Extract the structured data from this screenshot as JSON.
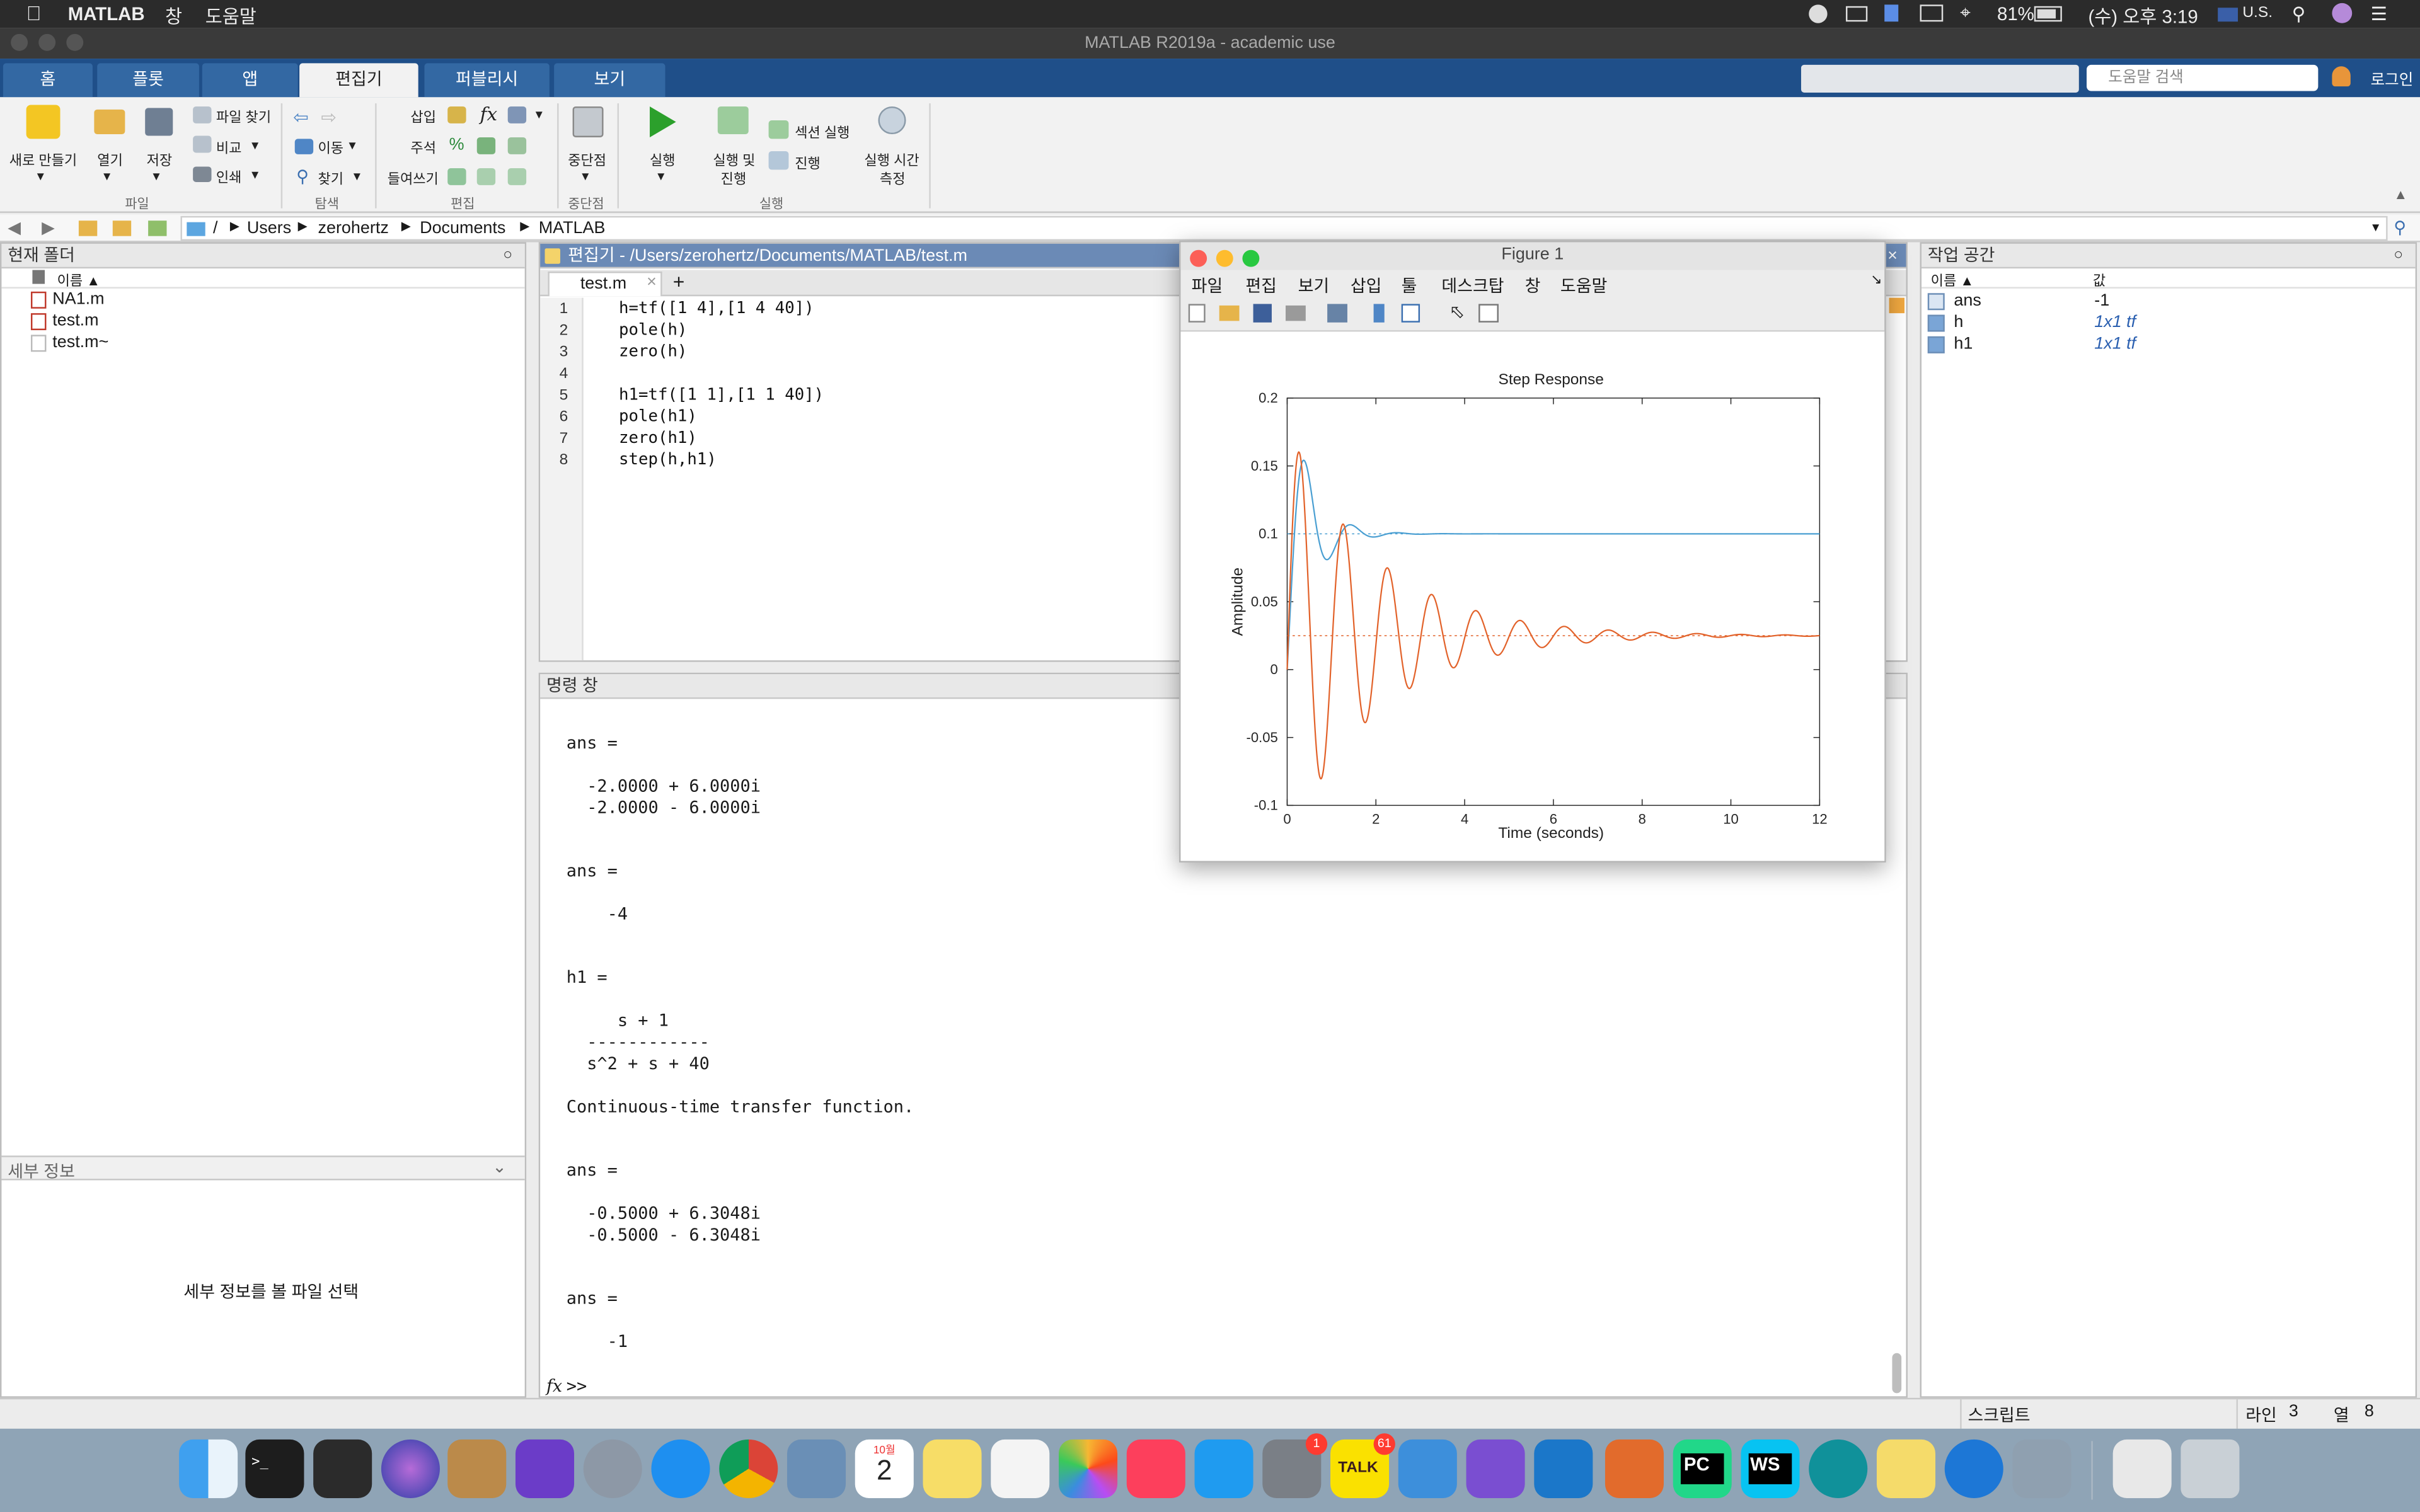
{
  "mac_menu": {
    "app": "MATLAB",
    "items": [
      "창",
      "도움말"
    ],
    "battery": "81%",
    "clock": "(수) 오후 3:19",
    "input_source": "U.S."
  },
  "window": {
    "title": "MATLAB R2019a - academic use"
  },
  "tabs": [
    "홈",
    "플롯",
    "앱",
    "편집기",
    "퍼블리시",
    "보기"
  ],
  "help_search": {
    "placeholder": "도움말 검색"
  },
  "login": "로그인",
  "ribbon": {
    "new": "새로 만들기",
    "open": "열기",
    "save": "저장",
    "find_file": "파일 찾기",
    "compare": "비교",
    "print": "인쇄",
    "go_to": "이동",
    "find": "찾기",
    "insert": "삽입",
    "comment": "주석",
    "indent": "들여쓰기",
    "breakpoints": "중단점",
    "run": "실행",
    "run_advance_1": "실행 및",
    "run_advance_2": "진행",
    "run_section": "섹션 실행",
    "advance": "진행",
    "run_time_1": "실행 시간",
    "run_time_2": "측정",
    "groups": {
      "file": "파일",
      "navigate": "탐색",
      "edit": "편집",
      "breakpoints": "중단점",
      "run": "실행"
    }
  },
  "address": {
    "root": "/",
    "path": [
      "Users",
      "zerohertz",
      "Documents",
      "MATLAB"
    ]
  },
  "current_folder": {
    "title": "현재 폴더",
    "column": "이름 ▲",
    "files": [
      "NA1.m",
      "test.m",
      "test.m~"
    ],
    "details_title": "세부 정보",
    "details_hint": "세부 정보를 볼 파일 선택"
  },
  "editor": {
    "title": "편집기 - /Users/zerohertz/Documents/MATLAB/test.m",
    "tab": "test.m",
    "lines": [
      "h=tf([1 4],[1 4 40])",
      "pole(h)",
      "zero(h)",
      "",
      "h1=tf([1 1],[1 1 40])",
      "pole(h1)",
      "zero(h1)",
      "step(h,h1)"
    ]
  },
  "command_window": {
    "title": "명령 창",
    "lines": [
      "ans =",
      "",
      "  -2.0000 + 6.0000i",
      "  -2.0000 - 6.0000i",
      "",
      "",
      "ans =",
      "",
      "    -4",
      "",
      "",
      "h1 =",
      "",
      "     s + 1",
      "  ------------",
      "  s^2 + s + 40",
      "",
      "Continuous-time transfer function.",
      "",
      "",
      "ans =",
      "",
      "  -0.5000 + 6.3048i",
      "  -0.5000 - 6.3048i",
      "",
      "",
      "ans =",
      "",
      "    -1"
    ],
    "prompt": ">>"
  },
  "workspace": {
    "title": "작업 공간",
    "col_name": "이름 ▲",
    "col_value": "값",
    "rows": [
      {
        "name": "ans",
        "value": "-1"
      },
      {
        "name": "h",
        "value": "1x1 tf"
      },
      {
        "name": "h1",
        "value": "1x1 tf"
      }
    ]
  },
  "figure": {
    "title": "Figure 1",
    "menu": [
      "파일",
      "편집",
      "보기",
      "삽입",
      "툴",
      "데스크탑",
      "창",
      "도움말"
    ]
  },
  "chart_data": {
    "type": "line",
    "title": "Step Response",
    "xlabel": "Time (seconds)",
    "ylabel": "Amplitude",
    "xlim": [
      0,
      12
    ],
    "ylim": [
      -0.1,
      0.2
    ],
    "xticks": [
      0,
      2,
      4,
      6,
      8,
      10,
      12
    ],
    "yticks": [
      -0.1,
      -0.05,
      0,
      0.05,
      0.1,
      0.15,
      0.2
    ],
    "grid": false,
    "series": [
      {
        "color": "#4a9fd2",
        "final_value": 0.1,
        "numerator": [
          1,
          4
        ],
        "denominator": [
          1,
          4,
          40
        ]
      },
      {
        "color": "#e2622a",
        "final_value": 0.025,
        "numerator": [
          1,
          1
        ],
        "denominator": [
          1,
          1,
          40
        ]
      }
    ]
  },
  "status": {
    "mode": "스크립트",
    "line_label": "라인",
    "line": "3",
    "col_label": "열",
    "col": "8"
  },
  "dock": {
    "calendar_month": "10월",
    "calendar_day": "2",
    "sysprefs_badge": "1",
    "kakao_badge": "61"
  }
}
